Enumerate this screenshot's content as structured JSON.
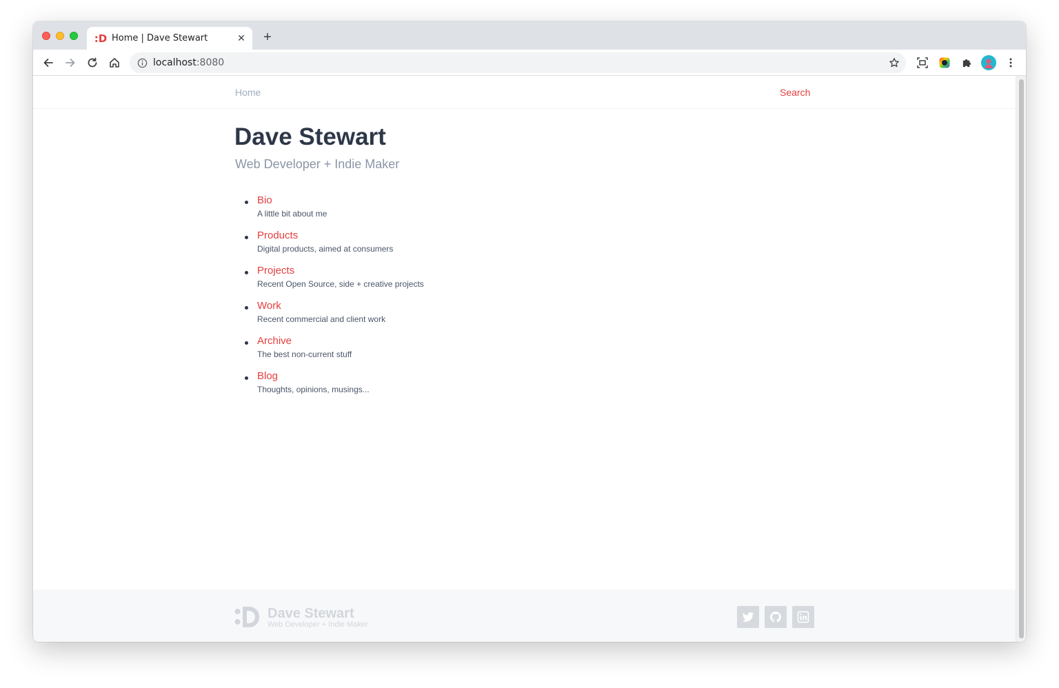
{
  "browser": {
    "tab": {
      "title": "Home | Dave Stewart",
      "favicon": ":D",
      "close": "✕"
    },
    "newtab": "+",
    "address": {
      "host": "localhost",
      "port": ":8080"
    }
  },
  "site": {
    "nav": {
      "home": "Home",
      "search": "Search"
    },
    "hero": {
      "title": "Dave Stewart",
      "subtitle": "Web Developer + Indie Maker"
    },
    "menu": [
      {
        "label": "Bio",
        "desc": "A little bit about me"
      },
      {
        "label": "Products",
        "desc": "Digital products, aimed at consumers"
      },
      {
        "label": "Projects",
        "desc": "Recent Open Source, side + creative projects"
      },
      {
        "label": "Work",
        "desc": "Recent commercial and client work"
      },
      {
        "label": "Archive",
        "desc": "The best non-current stuff"
      },
      {
        "label": "Blog",
        "desc": "Thoughts, opinions, musings..."
      }
    ],
    "footer": {
      "name": "Dave Stewart",
      "tagline": "Web Developer + Indie Maker",
      "social": [
        "twitter-icon",
        "github-icon",
        "linkedin-icon"
      ]
    }
  },
  "colors": {
    "accent": "#e53e3e",
    "heading": "#2d3748",
    "muted": "#a0aec0"
  }
}
